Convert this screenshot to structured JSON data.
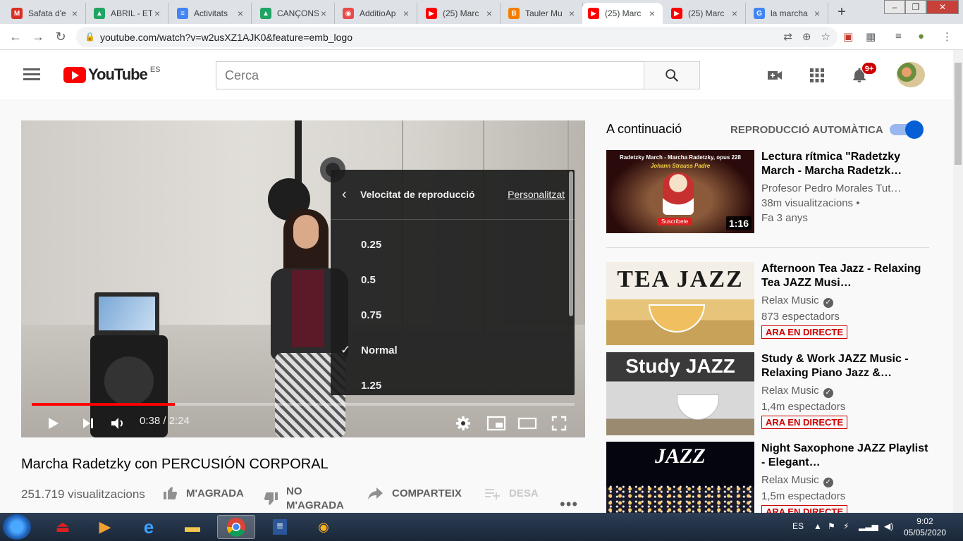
{
  "browser": {
    "tabs": [
      {
        "title": "Safata d'e",
        "favicon_color": "#d93025",
        "favicon_glyph": "M"
      },
      {
        "title": "ABRIL - ET",
        "favicon_color": "#1fa463",
        "favicon_glyph": "▲"
      },
      {
        "title": "Activitats",
        "favicon_color": "#4285f4",
        "favicon_glyph": "≡"
      },
      {
        "title": "CANÇONS",
        "favicon_color": "#1fa463",
        "favicon_glyph": "▲"
      },
      {
        "title": "AdditioAp",
        "favicon_color": "#e94b4b",
        "favicon_glyph": "◉"
      },
      {
        "title": "(25) Marc",
        "favicon_color": "#ff0000",
        "favicon_glyph": "▶"
      },
      {
        "title": "Tauler Mu",
        "favicon_color": "#f57d00",
        "favicon_glyph": "B"
      },
      {
        "title": "(25) Marc",
        "favicon_color": "#ff0000",
        "favicon_glyph": "▶"
      },
      {
        "title": "(25) Marc",
        "favicon_color": "#ff0000",
        "favicon_glyph": "▶"
      },
      {
        "title": "la marcha",
        "favicon_color": "#4285f4",
        "favicon_glyph": "G"
      }
    ],
    "active_tab_index": 7,
    "url": "youtube.com/watch?v=w2usXZ1AJK0&feature=emb_logo"
  },
  "youtube": {
    "logo_text": "YouTube",
    "country_code": "ES",
    "search_placeholder": "Cerca",
    "notifications_badge": "9+"
  },
  "player": {
    "current_time": "0:38",
    "duration": "2:24",
    "progress_fraction": 0.264,
    "settings": {
      "title": "Velocitat de reproducció",
      "custom_label": "Personalitzat",
      "options": [
        "0.25",
        "0.5",
        "0.75",
        "Normal",
        "1.25"
      ],
      "selected": "Normal"
    }
  },
  "video": {
    "title": "Marcha Radetzky con PERCUSIÓN CORPORAL",
    "views": "251.719 visualitzacions",
    "like_label": "M'AGRADA",
    "dislike_label": "NO M'AGRADA",
    "share_label": "COMPARTEIX",
    "save_label": "DESA"
  },
  "sidebar": {
    "up_next_label": "A continuació",
    "autoplay_label": "REPRODUCCIÓ AUTOMÀTICA",
    "autoplay_on": true,
    "videos": [
      {
        "title": "Lectura rítmica \"Radetzky March - Marcha Radetzk…",
        "channel": "Profesor Pedro Morales Tut…",
        "stats": "38m visualitzacions •",
        "age": "Fa 3 anys",
        "duration": "1:16",
        "thumb_top_text": "Radetzky March - Marcha Radetzky, opus 228",
        "thumb_sub_text": "Johann Strauss Padre",
        "thumb_button_text": "Suscríbete",
        "verified": false,
        "live": ""
      },
      {
        "title": "Afternoon Tea Jazz - Relaxing Tea JAZZ Musi…",
        "channel": "Relax Music",
        "stats": "873 espectadors",
        "age": "",
        "duration": "",
        "thumb_text": "TEA JAZZ",
        "verified": true,
        "live": "ARA EN DIRECTE"
      },
      {
        "title": "Study & Work JAZZ Music - Relaxing Piano Jazz &…",
        "channel": "Relax Music",
        "stats": "1,4m espectadors",
        "age": "",
        "duration": "",
        "thumb_text": "Study JAZZ",
        "verified": true,
        "live": "ARA EN DIRECTE"
      },
      {
        "title": "Night Saxophone JAZZ Playlist - Elegant…",
        "channel": "Relax Music",
        "stats": "1,5m espectadors",
        "age": "",
        "duration": "",
        "thumb_text": "JAZZ",
        "verified": true,
        "live": "ARA EN DIRECTE"
      }
    ]
  },
  "taskbar": {
    "language": "ES",
    "time": "9:02",
    "date": "05/05/2020"
  }
}
